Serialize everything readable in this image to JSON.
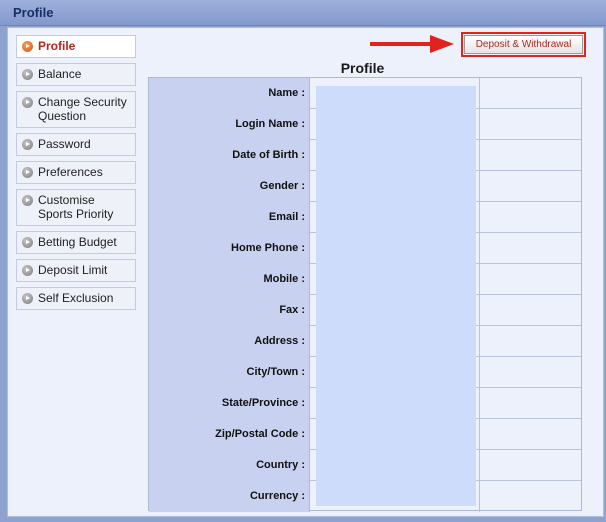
{
  "header": {
    "title": "Profile"
  },
  "sidebar": {
    "items": [
      {
        "label": "Profile",
        "active": true
      },
      {
        "label": "Balance"
      },
      {
        "label": "Change Security Question"
      },
      {
        "label": "Password"
      },
      {
        "label": "Preferences"
      },
      {
        "label": "Customise Sports Priority"
      },
      {
        "label": "Betting Budget"
      },
      {
        "label": "Deposit Limit"
      },
      {
        "label": "Self Exclusion"
      }
    ]
  },
  "toolbar": {
    "deposit_label": "Deposit & Withdrawal"
  },
  "profile": {
    "title": "Profile",
    "fields": [
      {
        "label": "Name :",
        "value": ""
      },
      {
        "label": "Login Name :",
        "value": ""
      },
      {
        "label": "Date of Birth :",
        "value": ""
      },
      {
        "label": "Gender :",
        "value": ""
      },
      {
        "label": "Email :",
        "value": ""
      },
      {
        "label": "Home Phone :",
        "value": ""
      },
      {
        "label": "Mobile :",
        "value": ""
      },
      {
        "label": "Fax :",
        "value": ""
      },
      {
        "label": "Address :",
        "value": ""
      },
      {
        "label": "City/Town :",
        "value": ""
      },
      {
        "label": "State/Province :",
        "value": ""
      },
      {
        "label": "Zip/Postal Code :",
        "value": ""
      },
      {
        "label": "Country :",
        "value": ""
      },
      {
        "label": "Currency :",
        "value": ""
      }
    ]
  },
  "colors": {
    "accent_red": "#e0231d",
    "active_text": "#b3281a",
    "label_bg": "#c8d2f0",
    "value_bg": "#cddcfb"
  }
}
